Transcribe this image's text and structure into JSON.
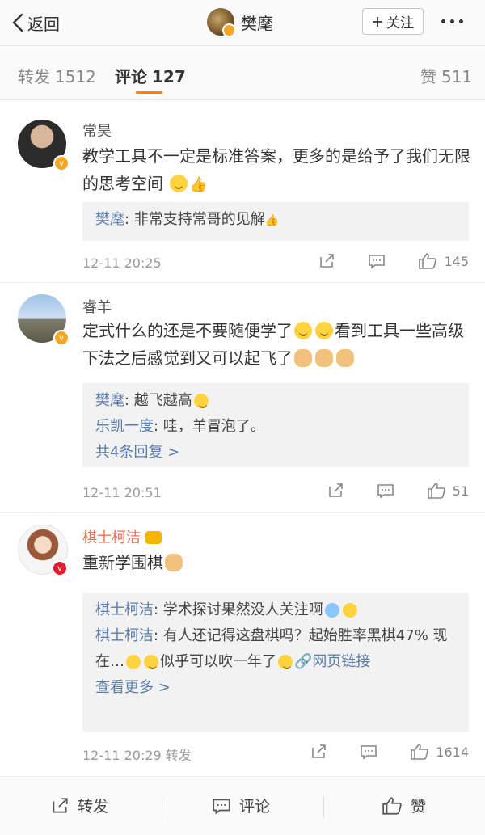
{
  "header": {
    "back_label": "返回",
    "title": "樊麾",
    "follow_label": "关注"
  },
  "tabs": [
    {
      "label": "转发",
      "count": "1512"
    },
    {
      "label": "评论",
      "count": "127"
    },
    {
      "label": "赞",
      "count": "511"
    }
  ],
  "comments": [
    {
      "name": "常昊",
      "text": "教学工具不一定是标准答案，更多的是给予了我们无限的思考空间",
      "replies": [
        {
          "who": "樊麾",
          "text": ": 非常支持常哥的见解"
        }
      ],
      "time": "12-11 20:25",
      "likes": "145"
    },
    {
      "name": "睿羊",
      "text": "定式什么的还是不要随便学了",
      "text2": "看到工具一些高级下法之后感觉到又可以起飞了",
      "replies": [
        {
          "who": "樊麾",
          "text": ": 越飞越高"
        },
        {
          "who": "乐凯一度",
          "text": ": 哇，羊冒泡了。"
        }
      ],
      "more": "共4条回复 >",
      "time": "12-11 20:51",
      "likes": "51"
    },
    {
      "name": "棋士柯洁",
      "text": "重新学围棋",
      "replies": [
        {
          "who": "棋士柯洁",
          "text": ": 学术探讨果然没人关注啊"
        },
        {
          "who": "棋士柯洁",
          "text": ": 有人还记得这盘棋吗？起始胜率黑棋47% 现在…",
          "text_after": "似乎可以吹一年了",
          "link": "网页链接"
        }
      ],
      "more": "查看更多 >",
      "time": "12-11 20:29",
      "repost": "转发",
      "likes": "1614"
    }
  ],
  "bottombar": {
    "repost": "转发",
    "comment": "评论",
    "like": "赞"
  }
}
